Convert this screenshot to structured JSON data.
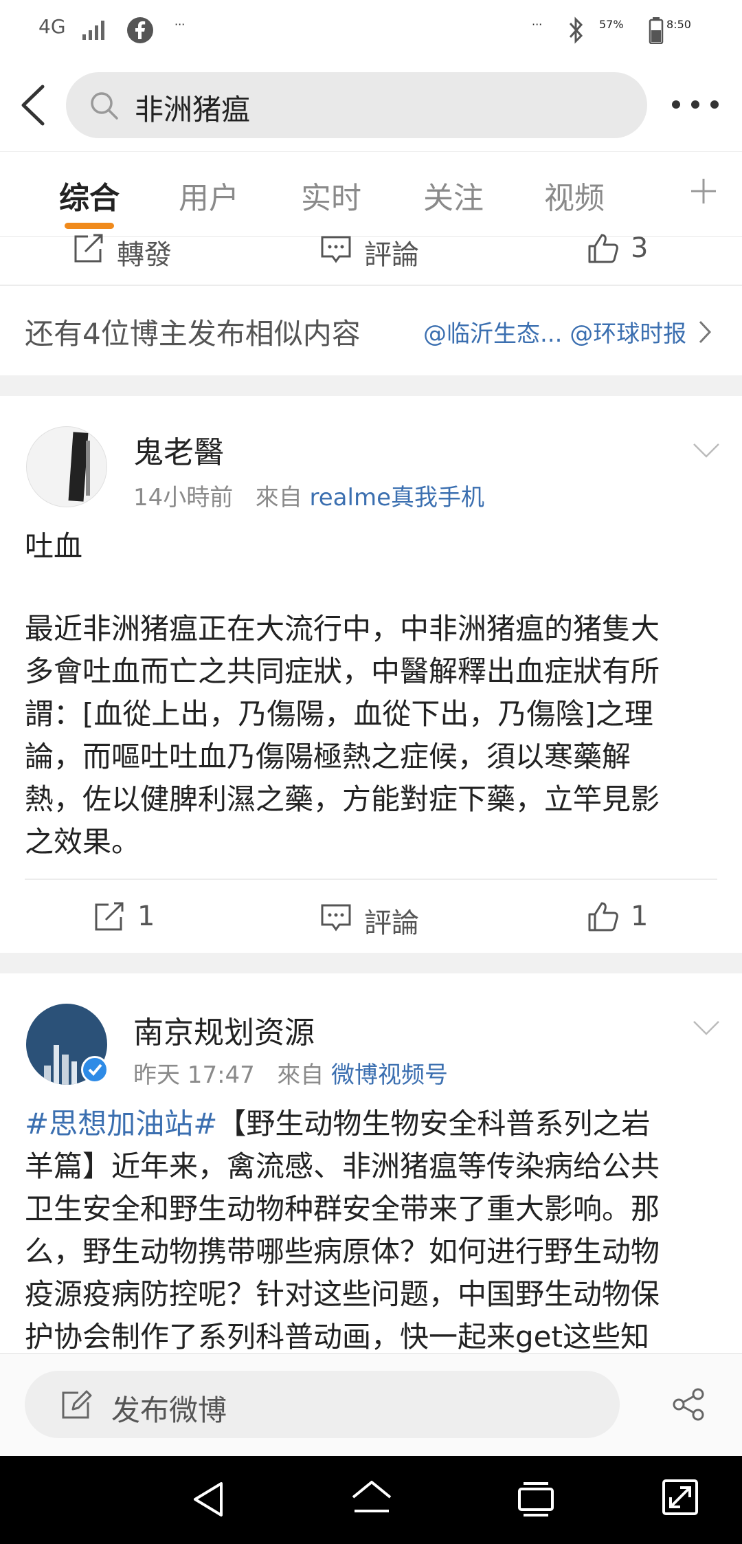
{
  "status_bar": {
    "network": "4G",
    "battery": "57%",
    "time": "8:50",
    "left_more": "···",
    "right_more": "···"
  },
  "search": {
    "query": "非洲猪瘟"
  },
  "tabs": [
    {
      "label": "综合",
      "active": true
    },
    {
      "label": "用户",
      "active": false
    },
    {
      "label": "实时",
      "active": false
    },
    {
      "label": "关注",
      "active": false
    },
    {
      "label": "视频",
      "active": false
    }
  ],
  "top_post_actions": {
    "repost": "轉發",
    "comment": "評論",
    "like": "3"
  },
  "similar": {
    "text": "还有4位博主发布相似内容",
    "mentions": "@临沂生态... @环球时报"
  },
  "post1": {
    "author": "鬼老醫",
    "time": "14小時前",
    "from_label": "來自",
    "source": "realme真我手机",
    "title": "吐血",
    "lines": [
      "最近非洲猪瘟正在大流行中，中非洲猪瘟的猪隻大",
      "多會吐血而亡之共同症狀，中醫解釋出血症狀有所",
      "謂：[血從上出，乃傷陽，血從下出，乃傷陰]之理",
      "論，而嘔吐吐血乃傷陽極熱之症候，須以寒藥解",
      "熱，佐以健脾利濕之藥，方能對症下藥，立竿見影",
      "之效果。"
    ],
    "repost_count": "1",
    "comment_label": "評論",
    "like_count": "1"
  },
  "post2": {
    "author": "南京规划资源",
    "time": "昨天 17:47",
    "from_label": "來自",
    "source": "微博视频号",
    "hashtag": "#思想加油站#",
    "line1_rest": "【野生动物生物安全科普系列之岩",
    "lines": [
      "羊篇】近年来，禽流感、非洲猪瘟等传染病给公共",
      "卫生安全和野生动物种群安全带来了重大影响。那",
      "么，野生动物携带哪些病原体？如何进行野生动物",
      "疫源疫病防控呢？针对这些问题，中国野生动物保",
      "护协会制作了系列科普动画，快一起来get这些知"
    ]
  },
  "compose": {
    "label": "发布微博"
  },
  "colors": {
    "accent": "#f08a1c",
    "link": "#3b6fb0"
  }
}
